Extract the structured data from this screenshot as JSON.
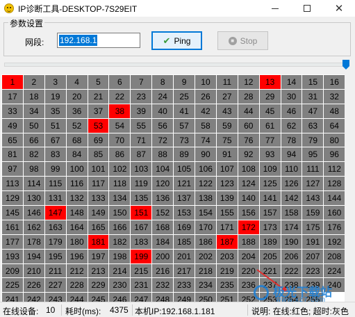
{
  "window": {
    "title": "IP诊断工具-DESKTOP-7S29EIT",
    "app_icon": "smiley-icon",
    "minimize": "minimize-icon",
    "maximize": "maximize-icon",
    "close": "close-icon"
  },
  "params": {
    "group_title": "参数设置",
    "segment_label": "网段:",
    "segment_value": "192.168.1",
    "ping_label": "Ping",
    "stop_label": "Stop"
  },
  "slider": {
    "value": 1.0
  },
  "grid": {
    "online_color": "#ff0000",
    "offline_color": "#808080",
    "online_ips": [
      1,
      13,
      38,
      53,
      147,
      151,
      172,
      181,
      187,
      199
    ],
    "range_start": 1,
    "range_end": 255
  },
  "status": {
    "online_label": "在线设备:",
    "online_count": "10",
    "elapsed_label": "耗时(ms):",
    "elapsed_value": "4375",
    "local_ip": "本机IP:192.168.1.181",
    "legend": "说明: 在线:红色; 超时:灰色"
  },
  "watermark": {
    "text": "极光下载站",
    "domain": "www.xz7.com"
  }
}
